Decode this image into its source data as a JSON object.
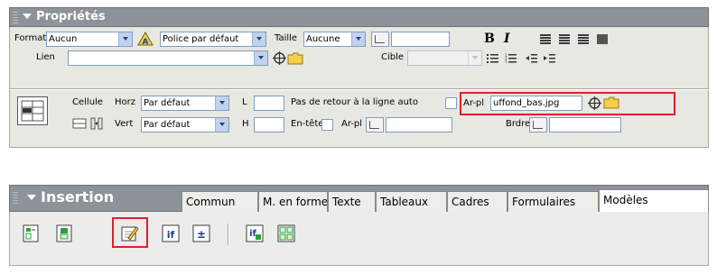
{
  "properties": {
    "title": "Propriétés",
    "format": {
      "label": "Format",
      "value": "Aucun"
    },
    "font": {
      "value": "Police par défaut"
    },
    "size": {
      "label": "Taille",
      "value": "Aucune"
    },
    "link": {
      "label": "Lien",
      "value": ""
    },
    "target": {
      "label": "Cible",
      "value": ""
    },
    "bold": "B",
    "italic": "I",
    "cell": {
      "label": "Cellule",
      "horz": {
        "label": "Horz",
        "value": "Par défaut"
      },
      "vert": {
        "label": "Vert",
        "value": "Par défaut"
      },
      "w_label": "L",
      "h_label": "H",
      "nowrap_label": "Pas de retour à la ligne auto",
      "header_label": "En-tête",
      "bg_label": "Ar-pl",
      "bg_image_value": "uffond_bas.jpg",
      "bg_color_label": "Ar-pl",
      "border_label": "Brdre"
    }
  },
  "insertion": {
    "title": "Insertion",
    "tabs": [
      "Commun",
      "M. en forme",
      "Texte",
      "Tableaux",
      "Cadres",
      "Formulaires",
      "Modèles"
    ],
    "active_tab": "Modèles",
    "icons": [
      "template-icon",
      "template-from-file-icon",
      "editable-region-icon",
      "optional-region-icon",
      "repeating-region-icon",
      "editable-optional-region-icon",
      "repeating-table-icon"
    ]
  },
  "highlight_color": "#e0202a"
}
